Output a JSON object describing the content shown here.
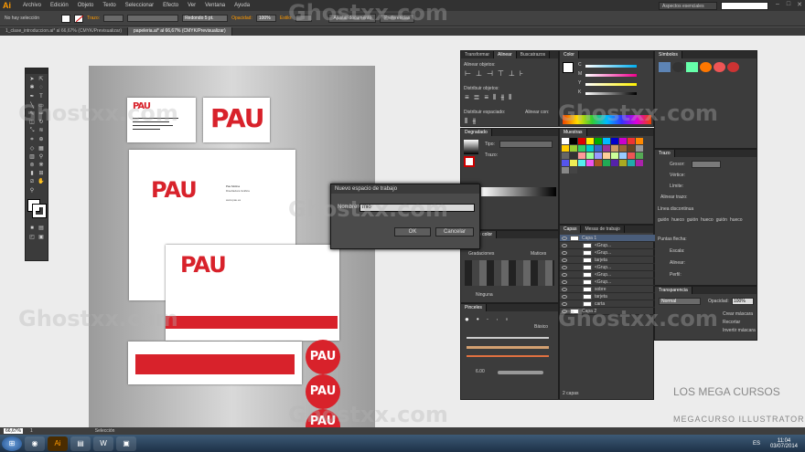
{
  "menubar": {
    "logo": "Ai",
    "items": [
      "Archivo",
      "Edición",
      "Objeto",
      "Texto",
      "Seleccionar",
      "Efecto",
      "Ver",
      "Ventana",
      "Ayuda"
    ],
    "workspace": "Aspectos esenciales"
  },
  "control": {
    "selection": "No hay selección",
    "stroke_label": "Trazo:",
    "brush": "Redondo 5 pt.",
    "opacity_label": "Opacidad:",
    "opacity": "100%",
    "style_label": "Estilo:",
    "doc_btn": "Ajustar documento",
    "prefs_btn": "Preferencias"
  },
  "tabs": [
    "1_clase_introduccion.ai* al 66,67% (CMYK/Previsualizar)",
    "papeleria.ai* al 66,67% (CMYK/Previsualizar)"
  ],
  "artboard": {
    "logo": "PAU",
    "name_text": "Pau Molina",
    "info": "Diseñadora Gráfica",
    "web": "www.pau.es"
  },
  "dialog": {
    "title": "Nuevo espacio de trabajo",
    "name_label": "Nombre:",
    "name_value": "mio",
    "ok": "OK",
    "cancel": "Cancelar"
  },
  "panels": {
    "align": {
      "tabs": [
        "Transformar",
        "Alinear",
        "Buscatrazos"
      ],
      "align_objects": "Alinear objetos:",
      "distribute_objects": "Distribuir objetos:",
      "distribute_spacing": "Distribuir espaciado:",
      "align_to": "Alinear con:"
    },
    "color": {
      "tab": "Color",
      "channels": [
        "C",
        "M",
        "Y",
        "K"
      ]
    },
    "symbols": {
      "tab": "Símbolos"
    },
    "gradient": {
      "tab": "Degradado",
      "type_label": "Tipo:",
      "stroke_label": "Trazo:"
    },
    "swatches": {
      "tab": "Muestras"
    },
    "stroke": {
      "tab": "Trazo",
      "weight_label": "Grosor:",
      "cap_label": "Vértice:",
      "corner_label": "Límite:",
      "align_label": "Alinear trazo:",
      "dashed": "Línea discontinua",
      "dash_labels": [
        "guión",
        "hueco",
        "guión",
        "hueco",
        "guión",
        "hueco"
      ],
      "arrow_label": "Puntas flecha:",
      "scale_label": "Escala:",
      "align2": "Alinear:",
      "profile": "Perfil:"
    },
    "transparency": {
      "tab": "Transparencia",
      "mode": "Normal",
      "opacity_label": "Opacidad:",
      "opacity": "100%",
      "mask_btn": "Crear máscara",
      "clip_label": "Recortar",
      "invert_label": "Invertir máscara"
    },
    "layers": {
      "tabs": [
        "Capas",
        "Mesas de trabajo"
      ],
      "rows": [
        "Capa 1",
        "<Grup...",
        "<Grup...",
        "tarjeta",
        "<Grup...",
        "<Grup...",
        "<Grup...",
        "sobre",
        "tarjeta",
        "carta",
        "Capa 2"
      ],
      "count": "2 capas"
    },
    "color_panel2": {
      "tabs": [
        "Guía de color"
      ],
      "sub": [
        "Gradaciones",
        "Matices"
      ],
      "none": "Ninguna"
    },
    "brushes": {
      "tab": "Pinceles",
      "basic": "Básico",
      "size": "6.00"
    }
  },
  "status": {
    "zoom": "66,67%",
    "page": "1",
    "mode": "Selección"
  },
  "taskbar": {
    "lang": "ES",
    "time": "11:04",
    "date": "03/07/2014"
  },
  "watermark": "Ghostxx.com",
  "brand": {
    "line1": "LOS MEGA CURSOS",
    "line2": "MEGACURSO ILLUSTRATOR",
    "accent": "#d8222b"
  }
}
